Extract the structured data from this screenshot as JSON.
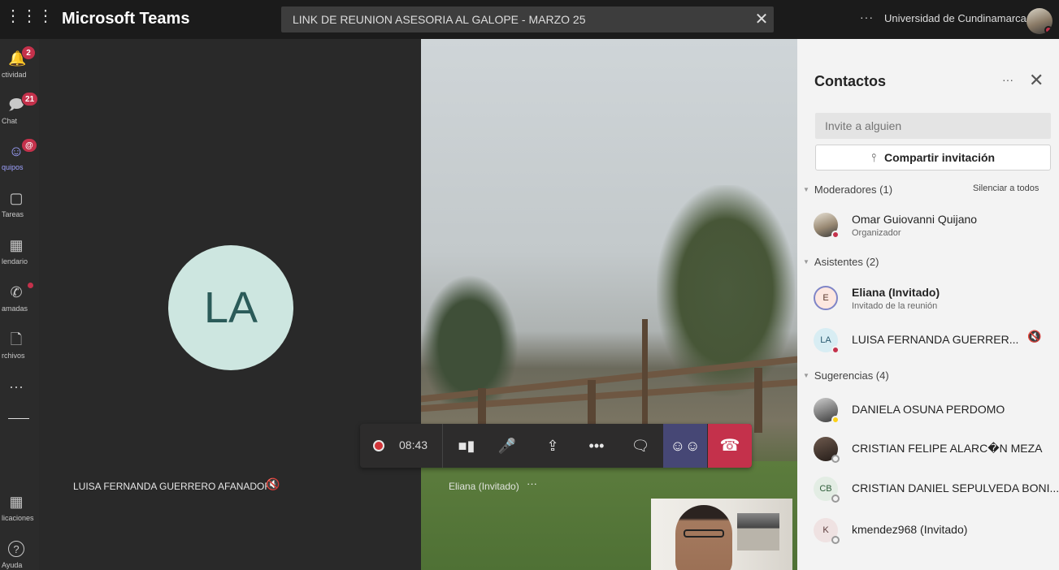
{
  "titlebar": {
    "app_name": "Microsoft Teams",
    "meeting_title": "LINK DE REUNION ASESORIA AL GALOPE - MARZO 25",
    "close_glyph": "✕",
    "more_glyph": "···",
    "org_name": "Universidad de Cundinamarca",
    "grid_glyph": "⋮⋮⋮"
  },
  "rail": {
    "items": [
      {
        "label": "ctividad",
        "icon": "bell-icon",
        "glyph": "🔔",
        "badge": "2"
      },
      {
        "label": "Chat",
        "icon": "chat-icon",
        "glyph": "💬",
        "badge": "21"
      },
      {
        "label": "quipos",
        "icon": "teams-icon",
        "glyph": "👥",
        "badge": "@"
      },
      {
        "label": "Tareas",
        "icon": "tasks-icon",
        "glyph": "🎒"
      },
      {
        "label": "lendario",
        "icon": "calendar-icon",
        "glyph": "📅"
      },
      {
        "label": "amadas",
        "icon": "phone-icon",
        "glyph": "✆"
      },
      {
        "label": "rchivos",
        "icon": "files-icon",
        "glyph": "🗋"
      },
      {
        "label": "",
        "icon": "more-icon",
        "glyph": "···"
      },
      {
        "label": "licaciones",
        "icon": "apps-icon",
        "glyph": "▦"
      },
      {
        "label": "Ayuda",
        "icon": "help-icon",
        "glyph": "?"
      }
    ]
  },
  "stage": {
    "left_initials": "LA",
    "left_name": "LUISA FERNANDA GUERRERO AFANADOR",
    "mic_off_glyph": "🎙̸",
    "video_name": "Eliana (Invitado)",
    "video_more": "···"
  },
  "callbar": {
    "timer": "08:43",
    "buttons": [
      {
        "name": "camera-button",
        "glyph": "■▮"
      },
      {
        "name": "mic-button",
        "glyph": "🎙"
      },
      {
        "name": "share-screen-button",
        "glyph": "⇪"
      },
      {
        "name": "more-actions-button",
        "glyph": "···"
      },
      {
        "name": "chat-button",
        "glyph": "💬"
      },
      {
        "name": "participants-button",
        "glyph": "👥"
      },
      {
        "name": "hang-up-button",
        "glyph": "☎"
      }
    ]
  },
  "panel": {
    "title": "Contactos",
    "more": "···",
    "close": "✕",
    "invite_placeholder": "Invite a alguien",
    "share_icon": "⩿",
    "share_label": "Compartir invitación",
    "sections": {
      "moderators": "Moderadores (1)",
      "mute_all": "Silenciar a todos",
      "attendees": "Asistentes (2)",
      "suggestions": "Sugerencias (4)"
    },
    "people": [
      {
        "name": "Omar Guiovanni Quijano",
        "sub": "Organizador",
        "initials": "",
        "status": "busy"
      },
      {
        "name": "Eliana (Invitado)",
        "sub": "Invitado de la reunión",
        "initials": "E",
        "status": ""
      },
      {
        "name": "LUISA FERNANDA GUERRER...",
        "sub": "",
        "initials": "LA",
        "status": "busy"
      },
      {
        "name": "DANIELA OSUNA PERDOMO",
        "sub": "",
        "initials": "",
        "status": "away"
      },
      {
        "name": "CRISTIAN FELIPE ALARC�N MEZA",
        "sub": "",
        "initials": "",
        "status": "offline"
      },
      {
        "name": "CRISTIAN DANIEL SEPULVEDA BONI...",
        "sub": "",
        "initials": "CB",
        "status": "offline"
      },
      {
        "name": "kmendez968 (Invitado)",
        "sub": "",
        "initials": "K",
        "status": "offline"
      }
    ]
  },
  "colors": {
    "accent": "#464775",
    "hangup": "#c4314b",
    "avatar_la_bg": "#cde6e0",
    "busy": "#c4314b",
    "away": "#fcd116"
  }
}
